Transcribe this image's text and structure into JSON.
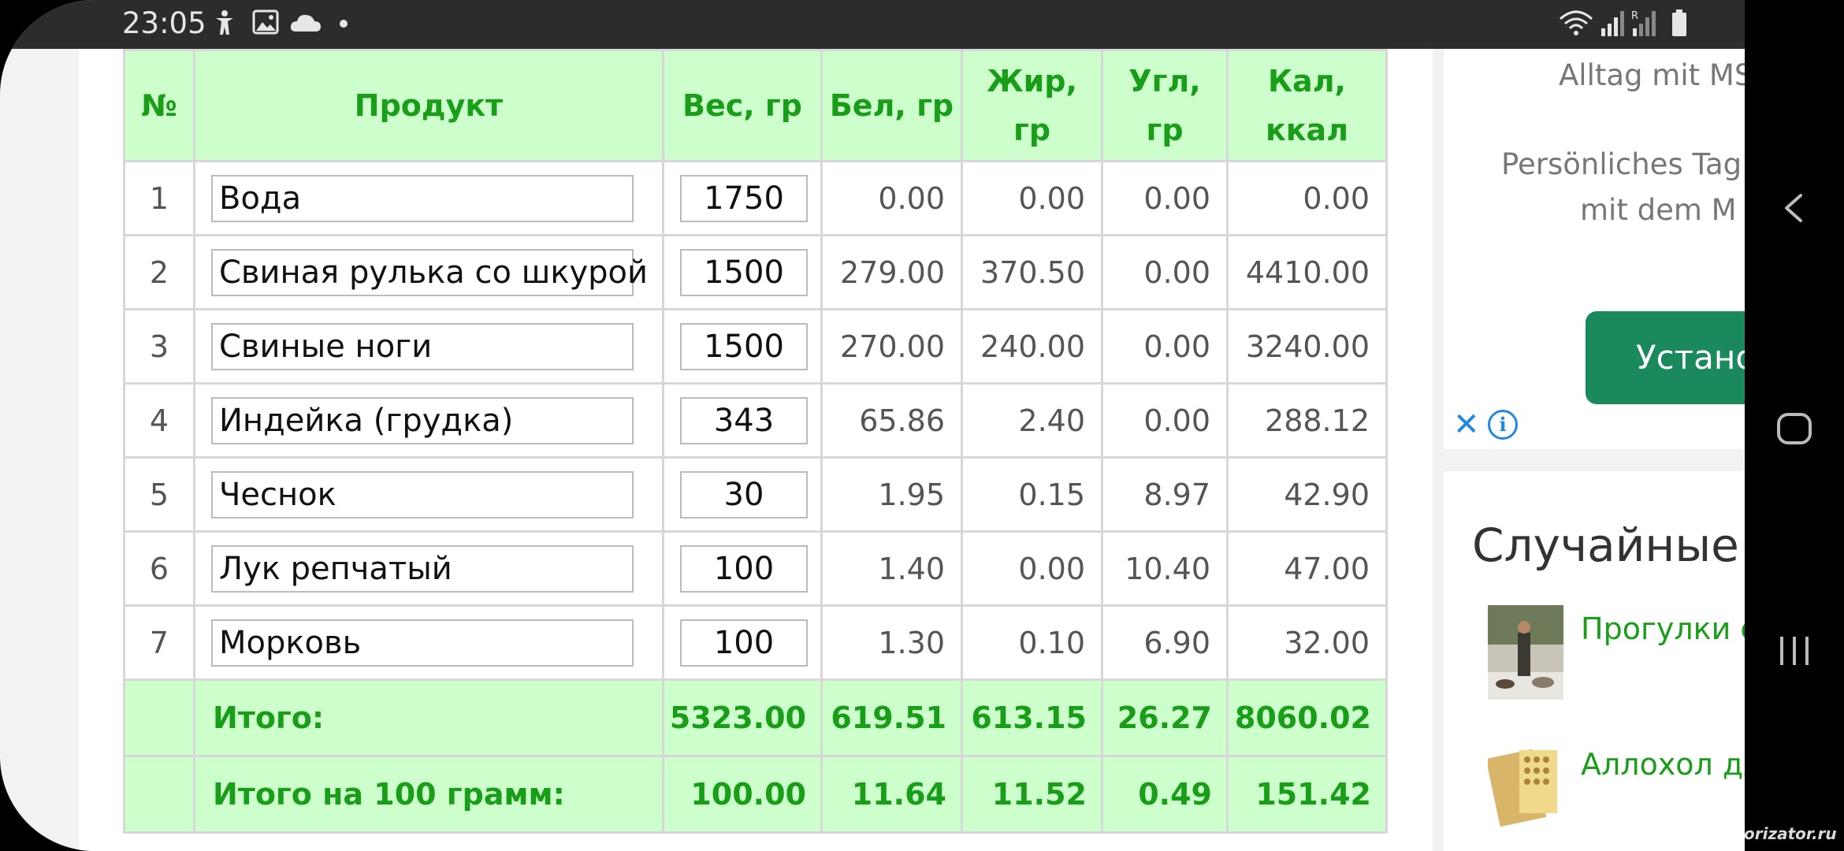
{
  "status": {
    "time": "23:05"
  },
  "table": {
    "headers": {
      "no": "№",
      "product": "Продукт",
      "weight": "Вес, гр",
      "protein": "Бел, гр",
      "fat_l1": "Жир,",
      "fat_l2": "гр",
      "carb_l1": "Угл,",
      "carb_l2": "гр",
      "cal_l1": "Кал,",
      "cal_l2": "ккал"
    },
    "rows": [
      {
        "n": "1",
        "name": "Вода",
        "w": "1750",
        "p": "0.00",
        "f": "0.00",
        "c": "0.00",
        "k": "0.00"
      },
      {
        "n": "2",
        "name": "Свиная рулька со шкурой",
        "w": "1500",
        "p": "279.00",
        "f": "370.50",
        "c": "0.00",
        "k": "4410.00"
      },
      {
        "n": "3",
        "name": "Свиные ноги",
        "w": "1500",
        "p": "270.00",
        "f": "240.00",
        "c": "0.00",
        "k": "3240.00"
      },
      {
        "n": "4",
        "name": "Индейка (грудка)",
        "w": "343",
        "p": "65.86",
        "f": "2.40",
        "c": "0.00",
        "k": "288.12"
      },
      {
        "n": "5",
        "name": "Чеснок",
        "w": "30",
        "p": "1.95",
        "f": "0.15",
        "c": "8.97",
        "k": "42.90"
      },
      {
        "n": "6",
        "name": "Лук репчатый",
        "w": "100",
        "p": "1.40",
        "f": "0.00",
        "c": "10.40",
        "k": "47.00"
      },
      {
        "n": "7",
        "name": "Морковь",
        "w": "100",
        "p": "1.30",
        "f": "0.10",
        "c": "6.90",
        "k": "32.00"
      }
    ],
    "total": {
      "label": "Итого:",
      "w": "5323.00",
      "p": "619.51",
      "f": "613.15",
      "c": "26.27",
      "k": "8060.02"
    },
    "per100": {
      "label": "Итого на 100 грамм:",
      "w": "100.00",
      "p": "11.64",
      "f": "11.52",
      "c": "0.49",
      "k": "151.42"
    }
  },
  "ad": {
    "line1": "Alltag mit MS",
    "line2": "Persönliches Tag",
    "line3": "mit dem M",
    "button": "Установить",
    "close": "✕",
    "info": "i"
  },
  "random": {
    "title": "Случайные статьи",
    "items": [
      {
        "label": "Прогулки с собакой"
      },
      {
        "label": "Аллохол для"
      }
    ]
  },
  "watermark": "Calorizator.ru",
  "colors": {
    "accent_green": "#1a9e1a",
    "header_bg": "#ccffcc",
    "install_button": "#1a8a5c",
    "statusbar": "#2c2c2e"
  }
}
